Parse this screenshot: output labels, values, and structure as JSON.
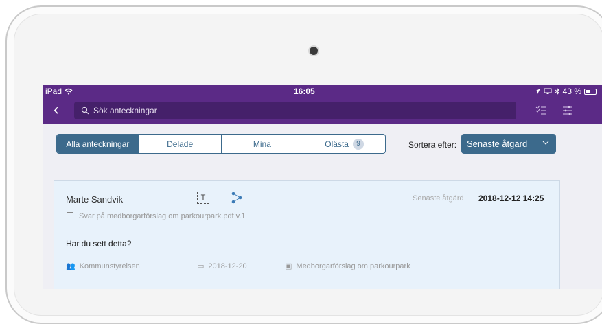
{
  "status": {
    "device": "iPad",
    "time": "16:05",
    "battery": "43 %"
  },
  "nav": {
    "search_placeholder": "Sök anteckningar",
    "icon_list": "checklist-icon",
    "icon_filter": "filter-icon"
  },
  "tabs": [
    {
      "label": "Alla anteckningar",
      "selected": true
    },
    {
      "label": "Delade"
    },
    {
      "label": "Mina"
    },
    {
      "label": "Olästa",
      "badge": "9"
    }
  ],
  "sort": {
    "label": "Sortera efter:",
    "value": "Senaste åtgärd"
  },
  "card": {
    "author": "Marte Sandvik",
    "type_icon": "T",
    "latest_label": "Senaste åtgärd",
    "latest_date": "2018-12-12 14:25",
    "file": "Svar på medborgarförslag om parkourpark.pdf v.1",
    "text": "Har du sett detta?",
    "group": "Kommunstyrelsen",
    "date": "2018-12-20",
    "case": "Medborgarförslag om parkourpark"
  },
  "colors": {
    "nav": "#5b2a86",
    "accent": "#3c6a8c",
    "card": "#e8f2fb"
  }
}
